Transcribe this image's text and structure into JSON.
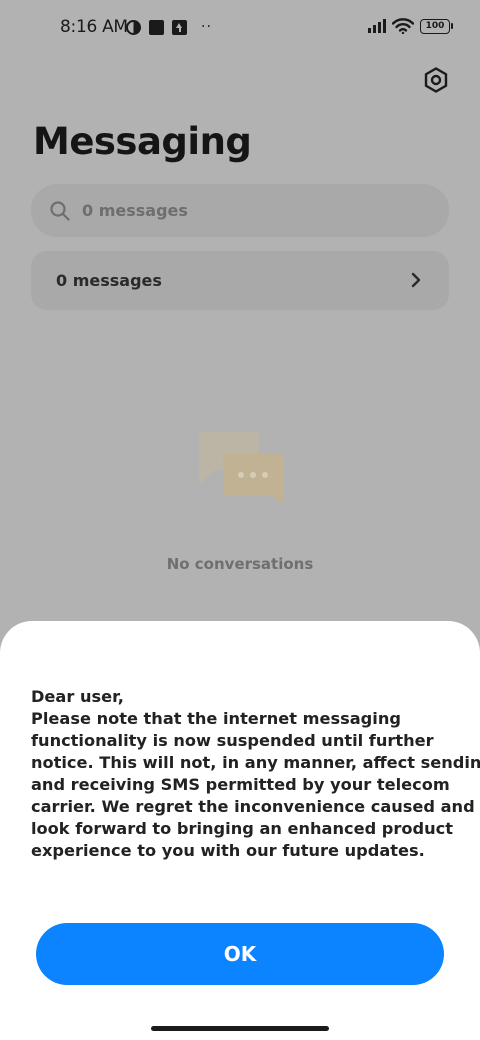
{
  "status_bar": {
    "time": "8:16 AM",
    "more": "··",
    "battery": "100"
  },
  "header": {
    "title": "Messaging"
  },
  "search": {
    "placeholder": "0 messages"
  },
  "messages_row": {
    "label": "0 messages"
  },
  "empty_state": {
    "text": "No conversations"
  },
  "dialog": {
    "lines": [
      "Dear user,",
      "Please note that the internet messaging",
      "functionality is now suspended until further",
      "notice. This will not, in any manner, affect sending",
      "and receiving SMS permitted by your telecom",
      "carrier. We regret the inconvenience caused and",
      "look forward to bringing an enhanced product",
      "experience to you with our future updates."
    ],
    "ok_label": "OK"
  },
  "colors": {
    "accent": "#0d84ff",
    "scrim_background": "#b2b2b2"
  }
}
